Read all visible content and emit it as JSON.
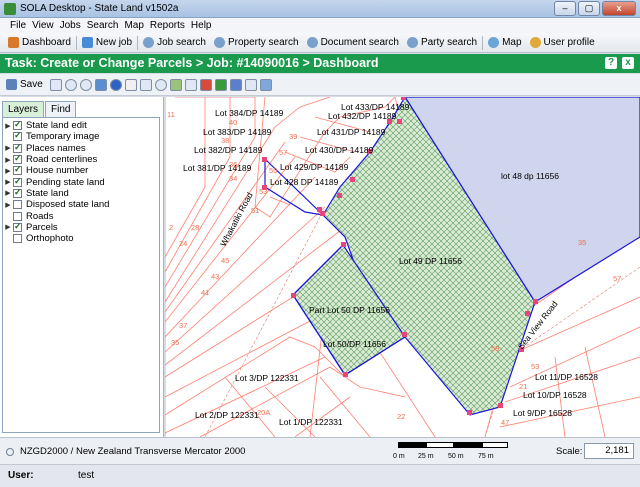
{
  "window": {
    "title": "SOLA Desktop - State Land v1502a",
    "controls": [
      "–",
      "▢",
      "x"
    ]
  },
  "menu": [
    "File",
    "View",
    "Jobs",
    "Search",
    "Map",
    "Reports",
    "Help"
  ],
  "toolbar": {
    "dashboard": "Dashboard",
    "new_job": "New job",
    "job_search": "Job search",
    "property_search": "Property search",
    "document_search": "Document search",
    "party_search": "Party search",
    "map": "Map",
    "user_profile": "User profile"
  },
  "task": {
    "title": "Task: Create or Change Parcels > Job: #14090016 > Dashboard",
    "help": "?",
    "close": "x"
  },
  "map_toolbar": {
    "save_label": "Save"
  },
  "panel": {
    "tabs": [
      "Layers",
      "Find"
    ],
    "layers": [
      {
        "label": "State land edit",
        "checked": true,
        "expand": true
      },
      {
        "label": "Temporary image",
        "checked": true,
        "expand": false
      },
      {
        "label": "Places names",
        "checked": true,
        "expand": true
      },
      {
        "label": "Road centerlines",
        "checked": true,
        "expand": true
      },
      {
        "label": "House number",
        "checked": true,
        "expand": true
      },
      {
        "label": "Pending state land",
        "checked": true,
        "expand": true
      },
      {
        "label": "State land",
        "checked": true,
        "expand": true
      },
      {
        "label": "Disposed state land",
        "checked": false,
        "expand": true
      },
      {
        "label": "Roads",
        "checked": false,
        "expand": false
      },
      {
        "label": "Parcels",
        "checked": true,
        "expand": true
      },
      {
        "label": "Orthophoto",
        "checked": false,
        "expand": false
      }
    ]
  },
  "map": {
    "parcel_labels": [
      "Lot 433/DP 14189",
      "Lot 384/DP 14189",
      "Lot 432/DP 14189",
      "Lot 383/DP 14189",
      "Lot 431/DP 14189",
      "Lot 382/DP 14189",
      "Lot 430/DP 14189",
      "Lot 429/DP 14189",
      "Lot 381/DP 14189",
      "Lot 428  DP 14189",
      "lot 48  dp 11656",
      "Lot 49  DP 11656",
      "Part Lot 50 DP 11656",
      "Lot 50/DP 11656",
      "Lot 3/DP 122331",
      "Lot 2/DP 122331",
      "Lot 1/DP 122331",
      "Lot 11/DP 16528",
      "Lot 10/DP 16528",
      "Lot 9/DP 16528"
    ],
    "road_labels": [
      "Whakatiki Road",
      "Sea View Road"
    ],
    "house_numbers": [
      "11",
      "40",
      "38",
      "36",
      "34",
      "53",
      "51",
      "57",
      "55",
      "39",
      "2",
      "28",
      "24",
      "45",
      "43",
      "41",
      "37",
      "35",
      "22",
      "20A",
      "53",
      "59",
      "47",
      "35",
      "57",
      "21"
    ],
    "colors": {
      "task_header": "#1a9a4c",
      "parcel_line": "#ff6e5e",
      "edit_outline": "#1a18d8",
      "selection_fill": "#cfd5ec",
      "hatch": "#4a8c4a",
      "vertex": "#e8467a"
    }
  },
  "status": {
    "crs": "NZGD2000 / New Zealand Transverse Mercator 2000",
    "scale_ticks": [
      "0 m",
      "25 m",
      "50 m",
      "75 m"
    ],
    "scale_label": "Scale:",
    "scale_value": "2,181",
    "user_label": "User:",
    "user_value": "test"
  }
}
